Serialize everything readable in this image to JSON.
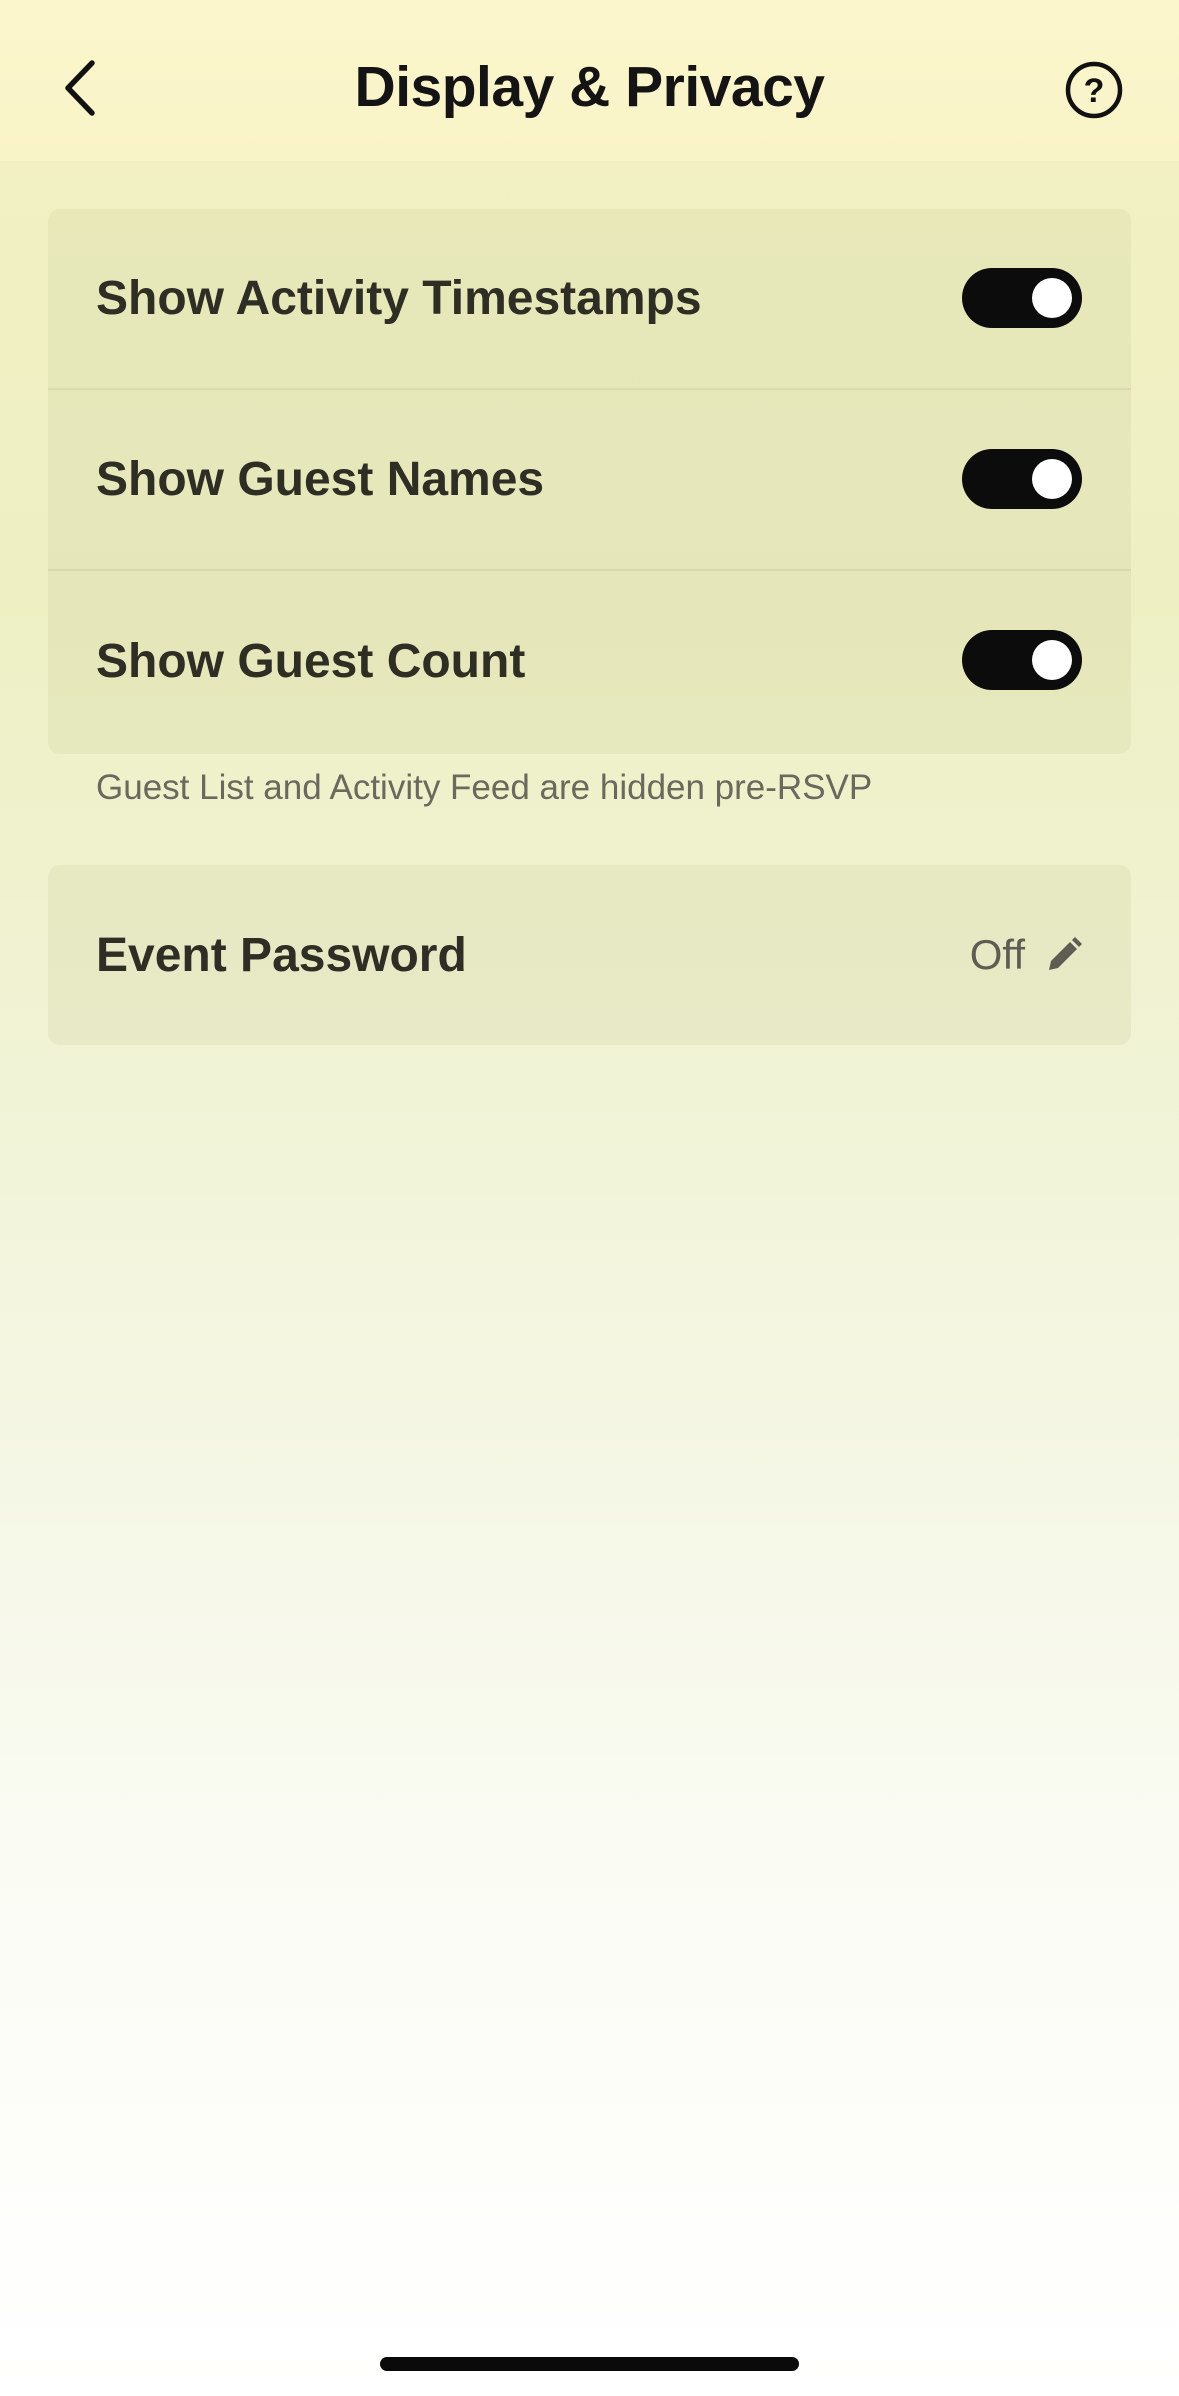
{
  "header": {
    "title": "Display & Privacy",
    "back_icon": "chevron-left-icon",
    "help_icon": "question-circle-icon"
  },
  "settings": {
    "toggles": [
      {
        "label": "Show Activity Timestamps",
        "on": true
      },
      {
        "label": "Show Guest Names",
        "on": true
      },
      {
        "label": "Show Guest Count",
        "on": true
      }
    ],
    "helper_text": "Guest List and Activity Feed are hidden pre-RSVP"
  },
  "password": {
    "label": "Event Password",
    "value": "Off",
    "edit_icon": "pencil-icon"
  },
  "colors": {
    "toggle_on": "#0c0c0c",
    "header_bg": "#fcf6cc"
  }
}
